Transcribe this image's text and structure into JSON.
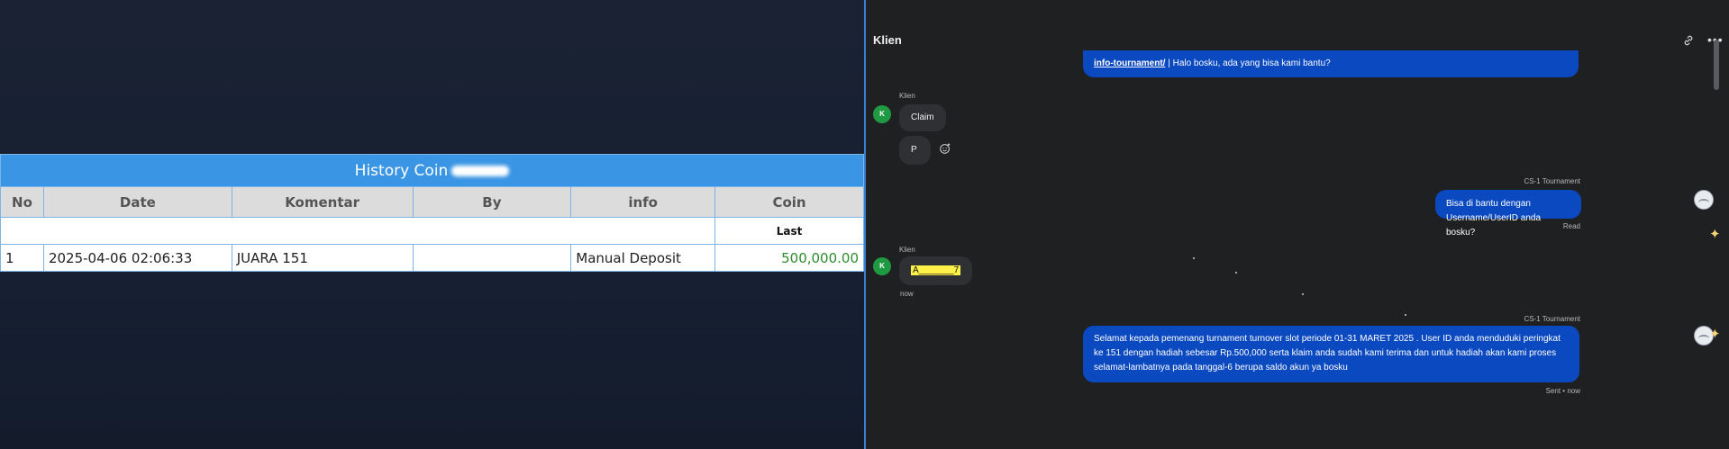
{
  "history": {
    "title": "History Coin",
    "columns": [
      "No",
      "Date",
      "Komentar",
      "By",
      "info",
      "Coin"
    ],
    "sub_label": "Last",
    "rows": [
      {
        "no": "1",
        "date": "2025-04-06 02:06:33",
        "komentar": "JUARA 151",
        "by": "",
        "info": "Manual Deposit",
        "coin": "500,000.00"
      }
    ]
  },
  "chat": {
    "title": "Klien",
    "header_icons": [
      "link-icon",
      "more-options-icon"
    ],
    "messages": [
      {
        "from": "agent",
        "link": "info-tournament/",
        "text": " | Halo bosku, ada yang bisa kami bantu?"
      },
      {
        "from": "client",
        "sender": "Klien",
        "avatar": "K",
        "texts": [
          "Claim",
          "P"
        ]
      },
      {
        "from": "agent",
        "sender": "CS-1 Tournament",
        "text": "Bisa di bantu dengan Username/UserID anda bosku?",
        "status": "Read"
      },
      {
        "from": "client",
        "sender": "Klien",
        "avatar": "K",
        "text": "A_______7",
        "time": "now"
      },
      {
        "from": "agent",
        "sender": "CS-1 Tournament",
        "text": "Selamat kepada pemenang turnament turnover slot periode 01-31 MARET 2025 . User ID anda menduduki peringkat ke 151 dengan hadiah sebesar Rp.500,000 serta klaim anda sudah kami terima dan untuk hadiah akan kami proses selamat-lambatnya pada tanggal-6 berupa saldo akun ya bosku",
        "status": "Sent • now"
      }
    ]
  },
  "colors": {
    "table_header": "#3a95e4",
    "agent_bubble": "#0b49c0",
    "client_bubble": "#2f3033",
    "coin_text": "#2e8b2e",
    "client_avatar": "#1f9a43"
  }
}
